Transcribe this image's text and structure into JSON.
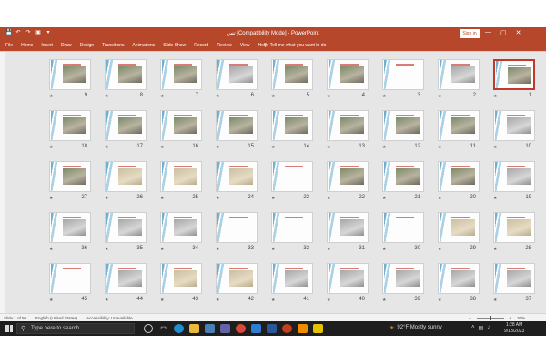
{
  "window": {
    "title": "تس [Compatibility Mode] - PowerPoint",
    "sign_in": "Sign in",
    "quick_access": [
      "💾",
      "↶",
      "↷",
      "▣",
      "▾"
    ],
    "controls": [
      "—",
      "▢",
      "✕"
    ]
  },
  "ribbon": {
    "tabs": [
      "File",
      "Home",
      "Insert",
      "Draw",
      "Design",
      "Transitions",
      "Animations",
      "Slide Show",
      "Record",
      "Review",
      "View",
      "Help"
    ],
    "tell_me": "Tell me what you want to do"
  },
  "slides": [
    {
      "n": "1",
      "kind": "photo"
    },
    {
      "n": "2",
      "kind": "grey"
    },
    {
      "n": "3",
      "kind": "blank"
    },
    {
      "n": "4",
      "kind": "photo"
    },
    {
      "n": "5",
      "kind": "photo"
    },
    {
      "n": "6",
      "kind": "grey"
    },
    {
      "n": "7",
      "kind": "photo"
    },
    {
      "n": "8",
      "kind": "photo"
    },
    {
      "n": "9",
      "kind": "photo"
    },
    {
      "n": "10",
      "kind": "grey"
    },
    {
      "n": "11",
      "kind": "photo"
    },
    {
      "n": "12",
      "kind": "photo"
    },
    {
      "n": "13",
      "kind": "photo"
    },
    {
      "n": "14",
      "kind": "photo"
    },
    {
      "n": "15",
      "kind": "photo"
    },
    {
      "n": "16",
      "kind": "photo"
    },
    {
      "n": "17",
      "kind": "photo"
    },
    {
      "n": "18",
      "kind": "photo"
    },
    {
      "n": "19",
      "kind": "grey"
    },
    {
      "n": "20",
      "kind": "photo"
    },
    {
      "n": "21",
      "kind": "photo"
    },
    {
      "n": "22",
      "kind": "photo"
    },
    {
      "n": "23",
      "kind": "blank"
    },
    {
      "n": "24",
      "kind": "paper"
    },
    {
      "n": "25",
      "kind": "paper"
    },
    {
      "n": "26",
      "kind": "paper"
    },
    {
      "n": "27",
      "kind": "photo"
    },
    {
      "n": "28",
      "kind": "paper"
    },
    {
      "n": "29",
      "kind": "paper"
    },
    {
      "n": "30",
      "kind": "blank"
    },
    {
      "n": "31",
      "kind": "grey"
    },
    {
      "n": "32",
      "kind": "blank"
    },
    {
      "n": "33",
      "kind": "blank"
    },
    {
      "n": "34",
      "kind": "grey"
    },
    {
      "n": "35",
      "kind": "grey"
    },
    {
      "n": "36",
      "kind": "grey"
    },
    {
      "n": "37",
      "kind": "grey"
    },
    {
      "n": "38",
      "kind": "grey"
    },
    {
      "n": "39",
      "kind": "grey"
    },
    {
      "n": "40",
      "kind": "grey"
    },
    {
      "n": "41",
      "kind": "grey"
    },
    {
      "n": "42",
      "kind": "paper"
    },
    {
      "n": "43",
      "kind": "paper"
    },
    {
      "n": "44",
      "kind": "grey"
    },
    {
      "n": "45",
      "kind": "blank"
    }
  ],
  "selected_slide": "1",
  "status": {
    "slide_of": "Slide 1 of 50",
    "language": "English (United States)",
    "accessibility": "Accessibility: Unavailable",
    "zoom": "30%"
  },
  "taskbar": {
    "search_placeholder": "Type here to search",
    "weather": "92°F  Mostly sunny",
    "time": "1:28 AM",
    "date": "9/13/2023"
  },
  "colors": {
    "accent": "#b7472a",
    "taskbar": "#1e1e1e",
    "selected_border": "#c0392b"
  }
}
